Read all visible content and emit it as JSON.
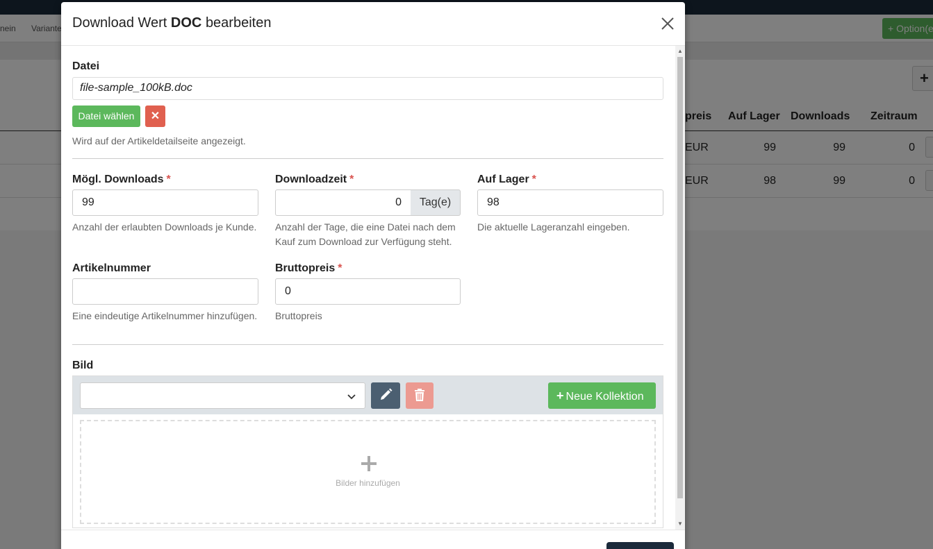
{
  "background": {
    "subnav": [
      "nein",
      "Variante"
    ],
    "option_button": "+ Option(e",
    "plus_button": "+",
    "table": {
      "headers": [
        "preis",
        "Auf Lager",
        "Downloads",
        "Zeitraum"
      ],
      "rows": [
        {
          "price": "EUR",
          "stock": "99",
          "downloads": "99",
          "period": "0"
        },
        {
          "price": "EUR",
          "stock": "98",
          "downloads": "99",
          "period": "0"
        }
      ]
    }
  },
  "modal": {
    "title_prefix": "Download Wert",
    "title_bold": "DOC",
    "title_suffix": "bearbeiten",
    "datei": {
      "label": "Datei",
      "filename": "file-sample_100kB.doc",
      "choose_button": "Datei wählen",
      "remove_button": "✕",
      "help": "Wird auf der Artikeldetailseite angezeigt."
    },
    "downloads": {
      "label": "Mögl. Downloads",
      "required": "*",
      "value": "99",
      "help": "Anzahl der erlaubten Downloads je Kunde."
    },
    "downloadzeit": {
      "label": "Downloadzeit",
      "required": "*",
      "value": "0",
      "addon": "Tag(e)",
      "help_line1": "Anzahl der Tage, die eine Datei nach dem",
      "help_line2": "Kauf zum Download zur Verfügung steht."
    },
    "lager": {
      "label": "Auf Lager",
      "required": "*",
      "value": "98",
      "help": "Die aktuelle Lageranzahl eingeben."
    },
    "artikelnummer": {
      "label": "Artikelnummer",
      "value": "",
      "help": "Eine eindeutige Artikelnummer hinzufügen."
    },
    "bruttopreis": {
      "label": "Bruttopreis",
      "required": "*",
      "value": "0",
      "help": "Bruttopreis"
    },
    "bild": {
      "label": "Bild",
      "selected": "",
      "neue_kollektion": "Neue Kollektion",
      "dropzone_text": "Bilder hinzufügen"
    }
  },
  "colors": {
    "green": "#5cb85c",
    "red": "#e0604f",
    "dark": "#1b2a3a",
    "required": "#d9534f"
  }
}
